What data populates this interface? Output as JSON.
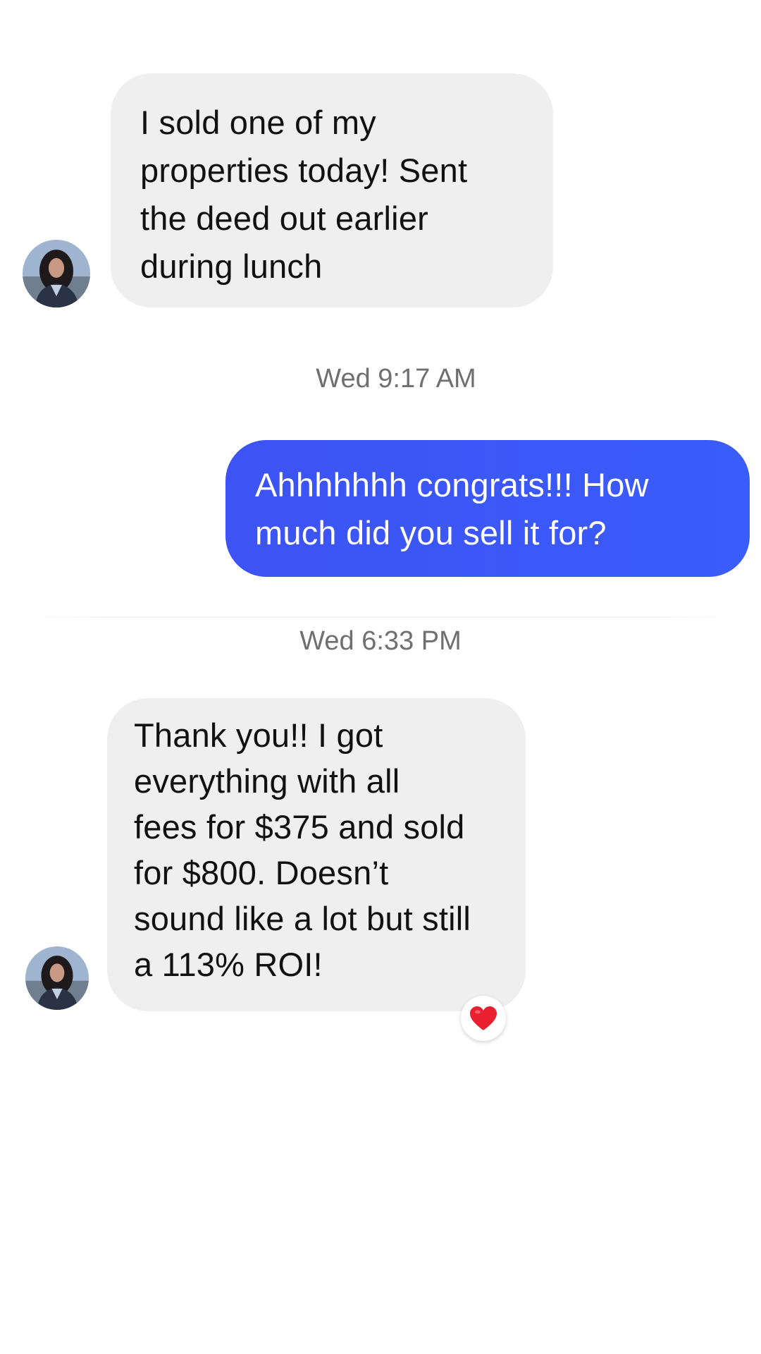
{
  "messages": [
    {
      "direction": "incoming",
      "text": "I sold one of my\nproperties today! Sent\nthe deed out earlier\nduring lunch"
    },
    {
      "direction": "outgoing",
      "text": "Ahhhhhhh congrats!!! How\nmuch did you sell it for?"
    },
    {
      "direction": "incoming",
      "text": "Thank you!! I got\neverything with all\nfees for $375 and sold\nfor $800. Doesn’t\nsound like a lot but still\na 113% ROI!",
      "reaction": "❤️"
    }
  ],
  "timestamps": [
    "Wed 9:17 AM",
    "Wed 6:33 PM"
  ],
  "colors": {
    "incoming_bubble": "#efefef",
    "outgoing_bubble": "#3a57f8",
    "timestamp_text": "#6f6f73"
  },
  "icons": {
    "avatar": "contact-avatar-photo",
    "reaction": "heart-icon"
  }
}
